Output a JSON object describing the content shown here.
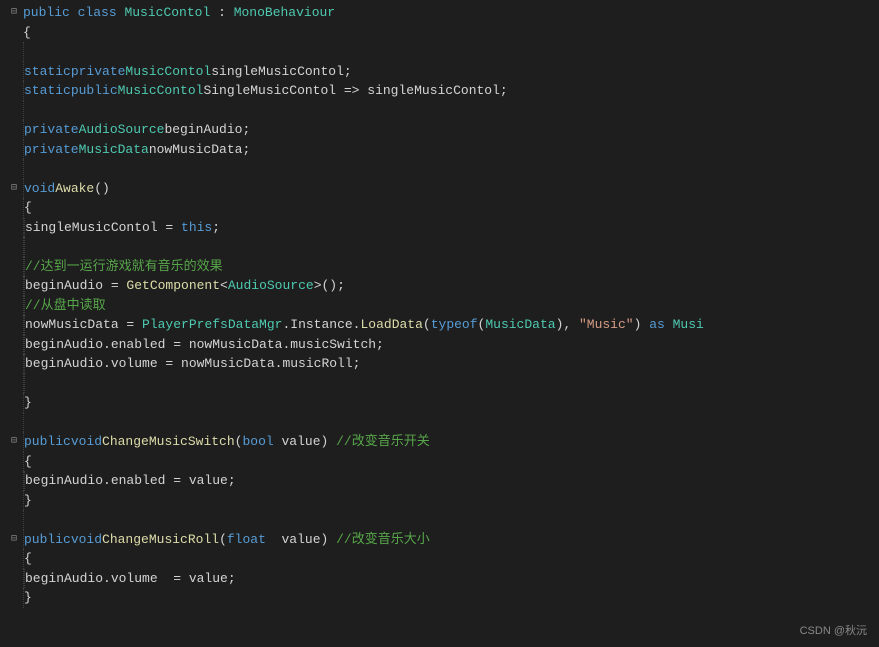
{
  "code": {
    "line1_public": "public",
    "line1_class": "class",
    "line1_classname": "MusicContol",
    "line1_colon": " : ",
    "line1_base": "MonoBehaviour",
    "line2_brace": "{",
    "line3_empty": "",
    "line4_static": "static",
    "line4_private": "private",
    "line4_type": "MusicContol",
    "line4_var": "singleMusicContol;",
    "line5_static": "static",
    "line5_public": "public",
    "line5_type": "MusicContol",
    "line5_prop": "SingleMusicContol => singleMusicContol;",
    "line7_private": "private",
    "line7_type": "AudioSource",
    "line7_var": "beginAudio;",
    "line8_private": "private",
    "line8_type": "MusicData",
    "line8_var": "nowMusicData;",
    "line10_void": "void",
    "line10_method": "Awake",
    "line10_parens": "()",
    "line11_brace": "{",
    "line12_var": "singleMusicContol",
    "line12_eq": " = ",
    "line12_this": "this",
    "line12_semi": ";",
    "line14_comment": "//达到一运行游戏就有音乐的效果",
    "line15_lhs": "beginAudio = ",
    "line15_method": "GetComponent",
    "line15_lt": "<",
    "line15_type": "AudioSource",
    "line15_gt": ">();",
    "line16_comment": "//从盘中读取",
    "line17_lhs": "nowMusicData = ",
    "line17_type1": "PlayerPrefsDataMgr",
    "line17_dot": ".Instance.",
    "line17_method": "LoadData",
    "line17_paren": "(",
    "line17_typeof": "typeof",
    "line17_paren2": "(",
    "line17_type2": "MusicData",
    "line17_close": "), ",
    "line17_str": "\"Music\"",
    "line17_close2": ") ",
    "line17_as": "as",
    "line17_type3": " Musi",
    "line18_text": "beginAudio.enabled = nowMusicData.musicSwitch;",
    "line19_text": "beginAudio.volume = nowMusicData.musicRoll;",
    "line21_brace": "}",
    "line23_public": "public",
    "line23_void": "void",
    "line23_method": "ChangeMusicSwitch",
    "line23_paren": "(",
    "line23_bool": "bool",
    "line23_param": " value) ",
    "line23_comment": "//改变音乐开关",
    "line24_brace": "{",
    "line25_text": "beginAudio.enabled = value;",
    "line26_brace": "}",
    "line28_public": "public",
    "line28_void": "void",
    "line28_method": "ChangeMusicRoll",
    "line28_paren": "(",
    "line28_float": "float",
    "line28_param": "  value) ",
    "line28_comment": "//改变音乐大小",
    "line29_brace": "{",
    "line30_text": "beginAudio.volume  = value;",
    "line31_brace": "}"
  },
  "watermark": "CSDN @秋沅"
}
